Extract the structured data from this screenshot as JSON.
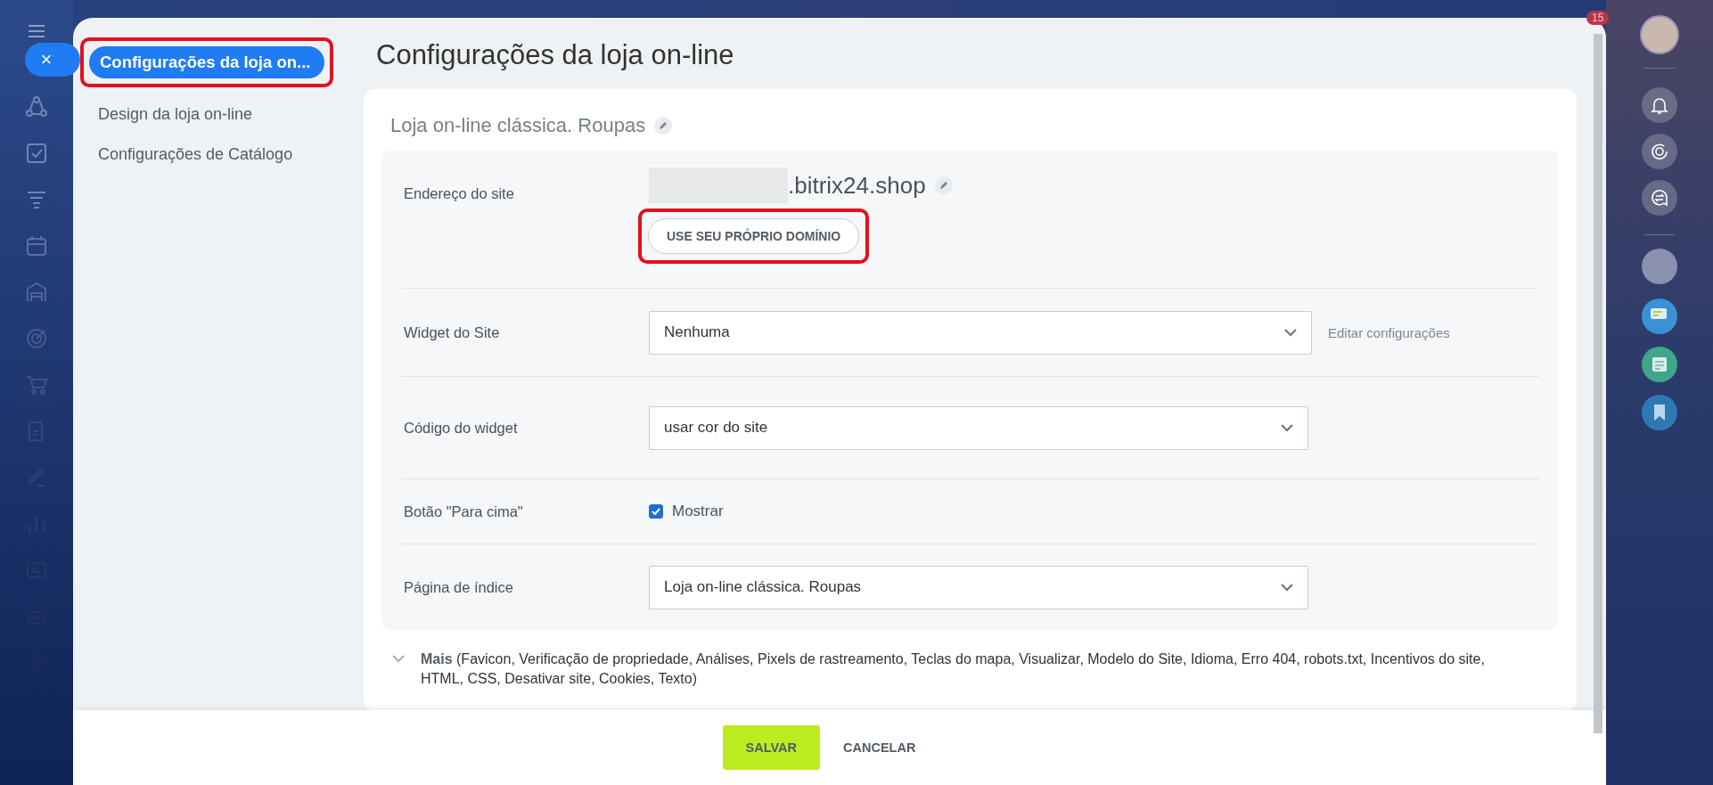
{
  "close_button": {
    "label": "×"
  },
  "notification_badge": "15",
  "menu": [
    {
      "label": "Configurações da loja on...",
      "selected": true
    },
    {
      "label": "Design da loja on-line",
      "selected": false
    },
    {
      "label": "Configurações de Catálogo",
      "selected": false
    }
  ],
  "page_title": "Configurações da loja on-line",
  "card": {
    "title": "Loja on-line clássica. Roupas"
  },
  "site_address": {
    "label": "Endereço do site",
    "domain_suffix": ".bitrix24.shop",
    "button": "USE SEU PRÓPRIO DOMÍNIO"
  },
  "fields": [
    {
      "kind": "select",
      "label": "Widget do Site",
      "value": "Nenhuma",
      "link": "Editar configurações"
    },
    {
      "kind": "select",
      "label": "Código do widget",
      "value": "usar cor do site"
    },
    {
      "kind": "checkbox",
      "label": "Botão \"Para cima\"",
      "option": "Mostrar",
      "checked": true
    },
    {
      "kind": "select",
      "label": "Página de índice",
      "value": "Loja on-line clássica. Roupas"
    }
  ],
  "more": {
    "label": "Mais",
    "text": "(Favicon,  Verificação de propriedade,  Análises,  Pixels de rastreamento,  Teclas do mapa,  Visualizar,  Modelo do Site,  Idioma,  Erro 404,  robots.txt,  Incentivos do site,  HTML,  CSS,  Desativar site,  Cookies,  Texto)"
  },
  "footer": {
    "buttons": [
      {
        "label": "SALVAR",
        "kind": "primary"
      },
      {
        "label": "CANCELAR",
        "kind": "link"
      }
    ]
  }
}
